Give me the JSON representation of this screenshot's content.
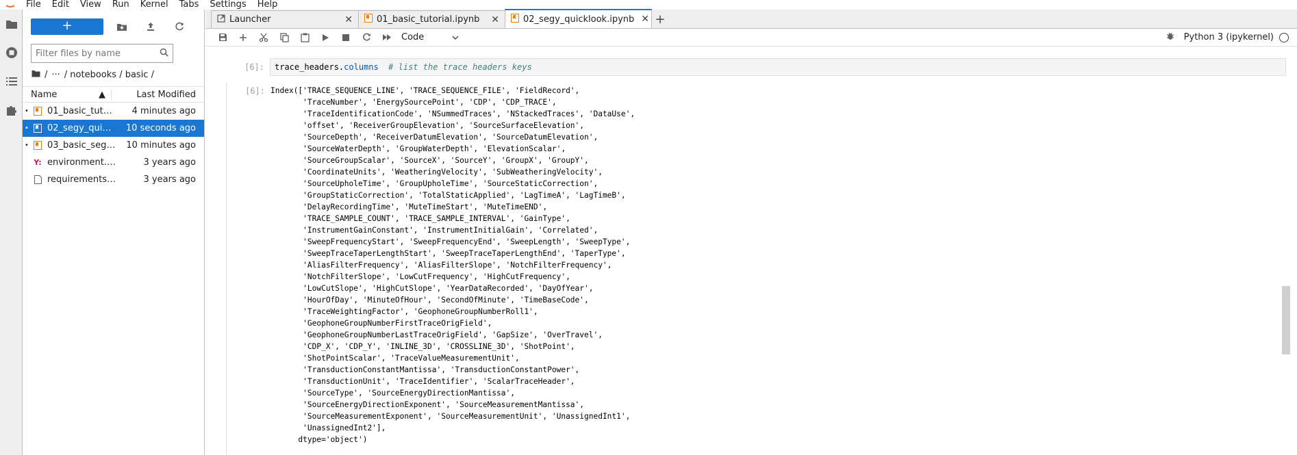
{
  "menubar": {
    "items": [
      "File",
      "Edit",
      "View",
      "Run",
      "Kernel",
      "Tabs",
      "Settings",
      "Help"
    ]
  },
  "sidebar_icons": [
    "folder-icon",
    "running-icon",
    "toc-icon",
    "extension-icon"
  ],
  "filebrowser": {
    "new_label": "+",
    "search_placeholder": "Filter files by name",
    "breadcrumb": [
      "/",
      "···",
      "/ notebooks / basic /"
    ],
    "col_name": "Name",
    "col_modified": "Last Modified",
    "files": [
      {
        "name": "01_basic_tutor...",
        "modified": "4 minutes ago",
        "kind": "notebook",
        "running": true,
        "selected": false
      },
      {
        "name": "02_segy_quick...",
        "modified": "10 seconds ago",
        "kind": "notebook",
        "running": true,
        "selected": true
      },
      {
        "name": "03_basic_segy...",
        "modified": "10 minutes ago",
        "kind": "notebook",
        "running": true,
        "selected": false
      },
      {
        "name": "environment.y...",
        "modified": "3 years ago",
        "kind": "yaml",
        "running": false,
        "selected": false
      },
      {
        "name": "requirements.txt",
        "modified": "3 years ago",
        "kind": "text",
        "running": false,
        "selected": false
      }
    ]
  },
  "tabs": [
    {
      "label": "Launcher",
      "active": false
    },
    {
      "label": "01_basic_tutorial.ipynb",
      "active": false
    },
    {
      "label": "02_segy_quicklook.ipynb",
      "active": true
    }
  ],
  "notebook_toolbar": {
    "cell_type": "Code",
    "kernel_name": "Python 3 (ipykernel)"
  },
  "cell": {
    "in_prompt": "[6]:",
    "code_obj": "trace_headers.",
    "code_attr": "columns",
    "code_comment": "  # list the trace headers keys",
    "out_prompt": "[6]:",
    "output": "Index(['TRACE_SEQUENCE_LINE', 'TRACE_SEQUENCE_FILE', 'FieldRecord',\n       'TraceNumber', 'EnergySourcePoint', 'CDP', 'CDP_TRACE',\n       'TraceIdentificationCode', 'NSummedTraces', 'NStackedTraces', 'DataUse',\n       'offset', 'ReceiverGroupElevation', 'SourceSurfaceElevation',\n       'SourceDepth', 'ReceiverDatumElevation', 'SourceDatumElevation',\n       'SourceWaterDepth', 'GroupWaterDepth', 'ElevationScalar',\n       'SourceGroupScalar', 'SourceX', 'SourceY', 'GroupX', 'GroupY',\n       'CoordinateUnits', 'WeatheringVelocity', 'SubWeatheringVelocity',\n       'SourceUpholeTime', 'GroupUpholeTime', 'SourceStaticCorrection',\n       'GroupStaticCorrection', 'TotalStaticApplied', 'LagTimeA', 'LagTimeB',\n       'DelayRecordingTime', 'MuteTimeStart', 'MuteTimeEND',\n       'TRACE_SAMPLE_COUNT', 'TRACE_SAMPLE_INTERVAL', 'GainType',\n       'InstrumentGainConstant', 'InstrumentInitialGain', 'Correlated',\n       'SweepFrequencyStart', 'SweepFrequencyEnd', 'SweepLength', 'SweepType',\n       'SweepTraceTaperLengthStart', 'SweepTraceTaperLengthEnd', 'TaperType',\n       'AliasFilterFrequency', 'AliasFilterSlope', 'NotchFilterFrequency',\n       'NotchFilterSlope', 'LowCutFrequency', 'HighCutFrequency',\n       'LowCutSlope', 'HighCutSlope', 'YearDataRecorded', 'DayOfYear',\n       'HourOfDay', 'MinuteOfHour', 'SecondOfMinute', 'TimeBaseCode',\n       'TraceWeightingFactor', 'GeophoneGroupNumberRoll1',\n       'GeophoneGroupNumberFirstTraceOrigField',\n       'GeophoneGroupNumberLastTraceOrigField', 'GapSize', 'OverTravel',\n       'CDP_X', 'CDP_Y', 'INLINE_3D', 'CROSSLINE_3D', 'ShotPoint',\n       'ShotPointScalar', 'TraceValueMeasurementUnit',\n       'TransductionConstantMantissa', 'TransductionConstantPower',\n       'TransductionUnit', 'TraceIdentifier', 'ScalarTraceHeader',\n       'SourceType', 'SourceEnergyDirectionMantissa',\n       'SourceEnergyDirectionExponent', 'SourceMeasurementMantissa',\n       'SourceMeasurementExponent', 'SourceMeasurementUnit', 'UnassignedInt1',\n       'UnassignedInt2'],\n      dtype='object')"
  },
  "colors": {
    "accent": "#1976d2",
    "notebook_icon": "#f57c00",
    "yaml_icon": "#c2185b"
  }
}
